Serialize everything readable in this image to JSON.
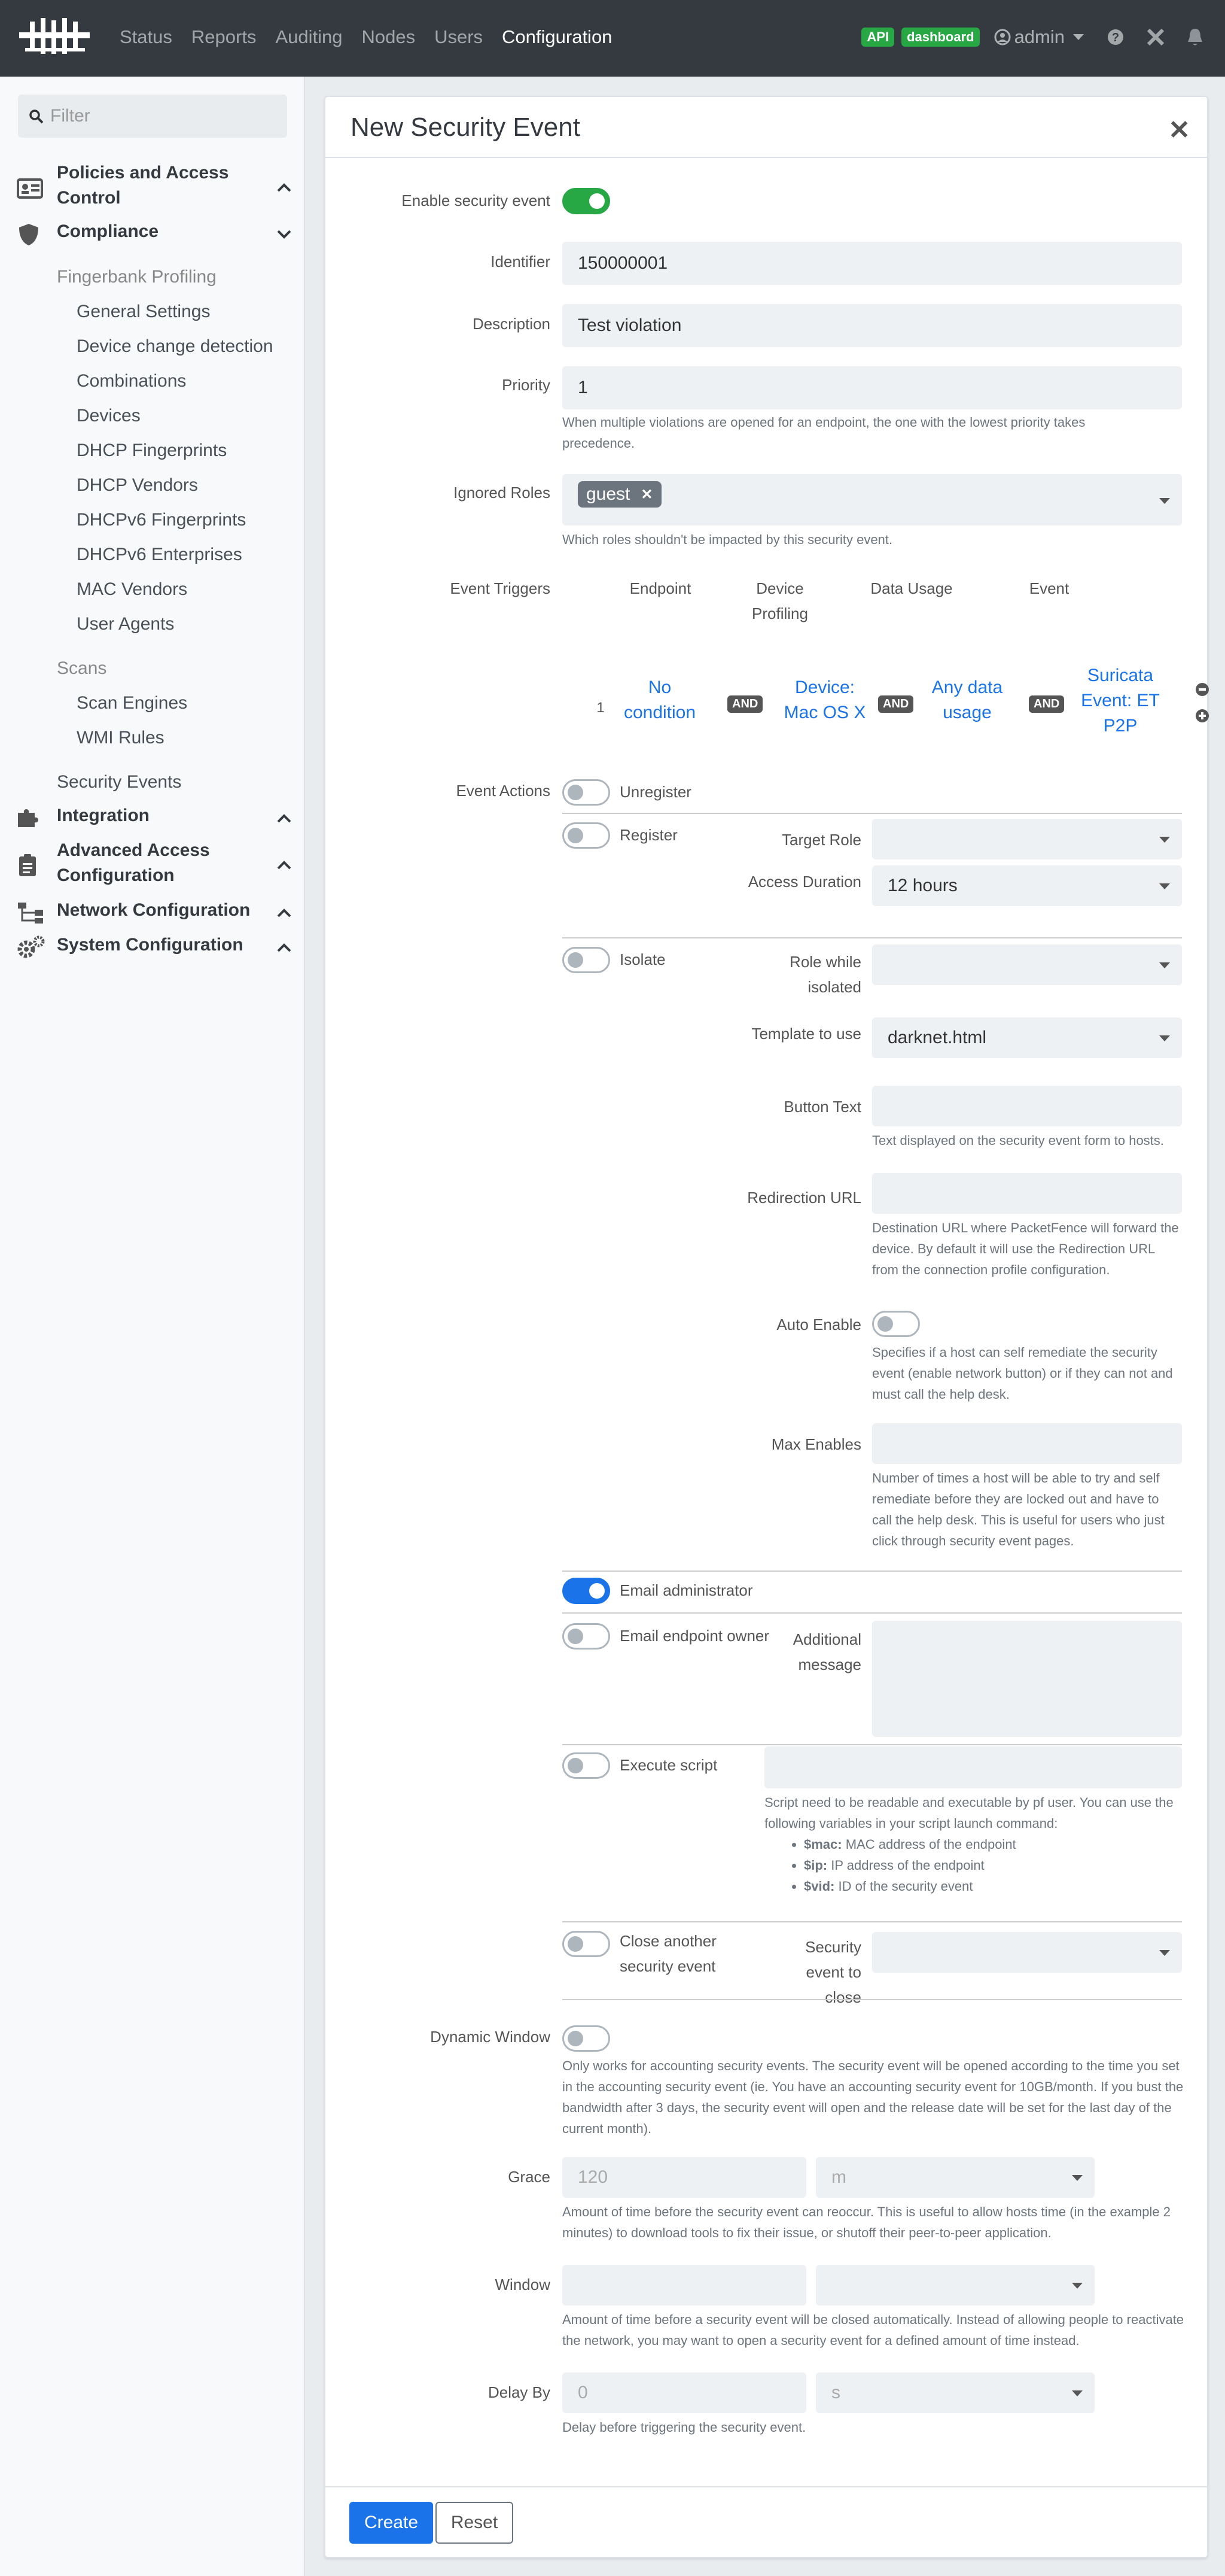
{
  "header": {
    "nav": [
      "Status",
      "Reports",
      "Auditing",
      "Nodes",
      "Users",
      "Configuration"
    ],
    "badges": [
      "API",
      "dashboard"
    ],
    "user": "admin"
  },
  "sidebar": {
    "filter_placeholder": "Filter",
    "sections": [
      {
        "label": "Policies and Access Control",
        "icon": "id-card-icon"
      },
      {
        "label": "Compliance",
        "icon": "shield-icon"
      },
      {
        "label": "Integration",
        "icon": "puzzle-icon"
      },
      {
        "label": "Advanced Access Configuration",
        "icon": "clipboard-icon"
      },
      {
        "label": "Network Configuration",
        "icon": "network-icon"
      },
      {
        "label": "System Configuration",
        "icon": "cogs-icon"
      }
    ],
    "fingerbank": {
      "label": "Fingerbank Profiling",
      "items": [
        "General Settings",
        "Device change detection",
        "Combinations",
        "Devices",
        "DHCP Fingerprints",
        "DHCP Vendors",
        "DHCPv6 Fingerprints",
        "DHCPv6 Enterprises",
        "MAC Vendors",
        "User Agents"
      ]
    },
    "scans": {
      "label": "Scans",
      "items": [
        "Scan Engines",
        "WMI Rules"
      ]
    },
    "security_events": "Security Events"
  },
  "form": {
    "title": "New Security Event",
    "enable_label": "Enable security event",
    "identifier_label": "Identifier",
    "identifier": "150000001",
    "description_label": "Description",
    "description": "Test violation",
    "priority_label": "Priority",
    "priority": "1",
    "priority_help": "When multiple violations are opened for an endpoint, the one with the lowest priority takes precedence.",
    "roles_label": "Ignored Roles",
    "role_chip": "guest",
    "roles_help": "Which roles shouldn't be impacted by this security event.",
    "triggers_label": "Event Triggers",
    "trigger_headers": {
      "endpoint": "Endpoint",
      "device": "Device Profiling",
      "data": "Data Usage",
      "event": "Event"
    },
    "trigger_row": {
      "index": "1",
      "endpoint": "No condition",
      "device": "Device: Mac OS X",
      "data": "Any data usage",
      "event": "Suricata Event: ET P2P",
      "and": "AND"
    },
    "actions_label": "Event Actions",
    "unregister": "Unregister",
    "register": "Register",
    "target_role_label": "Target Role",
    "access_duration_label": "Access Duration",
    "access_duration": "12 hours",
    "isolate": "Isolate",
    "role_isolated_label": "Role while isolated",
    "template_label": "Template to use",
    "template": "darknet.html",
    "button_text_label": "Button Text",
    "button_text_help": "Text displayed on the security event form to hosts.",
    "redirection_label": "Redirection URL",
    "redirection_help": "Destination URL where PacketFence will forward the device. By default it will use the Redirection URL from the connection profile configuration.",
    "auto_enable_label": "Auto Enable",
    "auto_enable_help": "Specifies if a host can self remediate the security event (enable network button) or if they can not and must call the help desk.",
    "max_enables_label": "Max Enables",
    "max_enables_help": "Number of times a host will be able to try and self remediate before they are locked out and have to call the help desk. This is useful for users who just click through security event pages.",
    "email_admin": "Email administrator",
    "email_owner": "Email endpoint owner",
    "additional_message_label": "Additional message",
    "execute_script": "Execute script",
    "script_help": "Script need to be readable and executable by pf user. You can use the following variables in your script launch command:",
    "script_vars": [
      {
        "k": "$mac:",
        "v": "MAC address of the endpoint"
      },
      {
        "k": "$ip:",
        "v": "IP address of the endpoint"
      },
      {
        "k": "$vid:",
        "v": "ID of the security event"
      }
    ],
    "close_another": "Close another security event",
    "event_to_close_label": "Security event to close",
    "dynamic_window_label": "Dynamic Window",
    "dynamic_window_help": "Only works for accounting security events. The security event will be opened according to the time you set in the accounting security event (ie. You have an accounting security event for 10GB/month. If you bust the bandwidth after 3 days, the security event will open and the release date will be set for the last day of the current month).",
    "grace_label": "Grace",
    "grace_value": "120",
    "grace_unit": "m",
    "grace_help": "Amount of time before the security event can reoccur. This is useful to allow hosts time (in the example 2 minutes) to download tools to fix their issue, or shutoff their peer-to-peer application.",
    "window_label": "Window",
    "window_help": "Amount of time before a security event will be closed automatically. Instead of allowing people to reactivate the network, you may want to open a security event for a defined amount of time instead.",
    "delay_label": "Delay By",
    "delay_value": "0",
    "delay_unit": "s",
    "delay_help": "Delay before triggering the security event.",
    "create_button": "Create",
    "reset_button": "Reset"
  }
}
